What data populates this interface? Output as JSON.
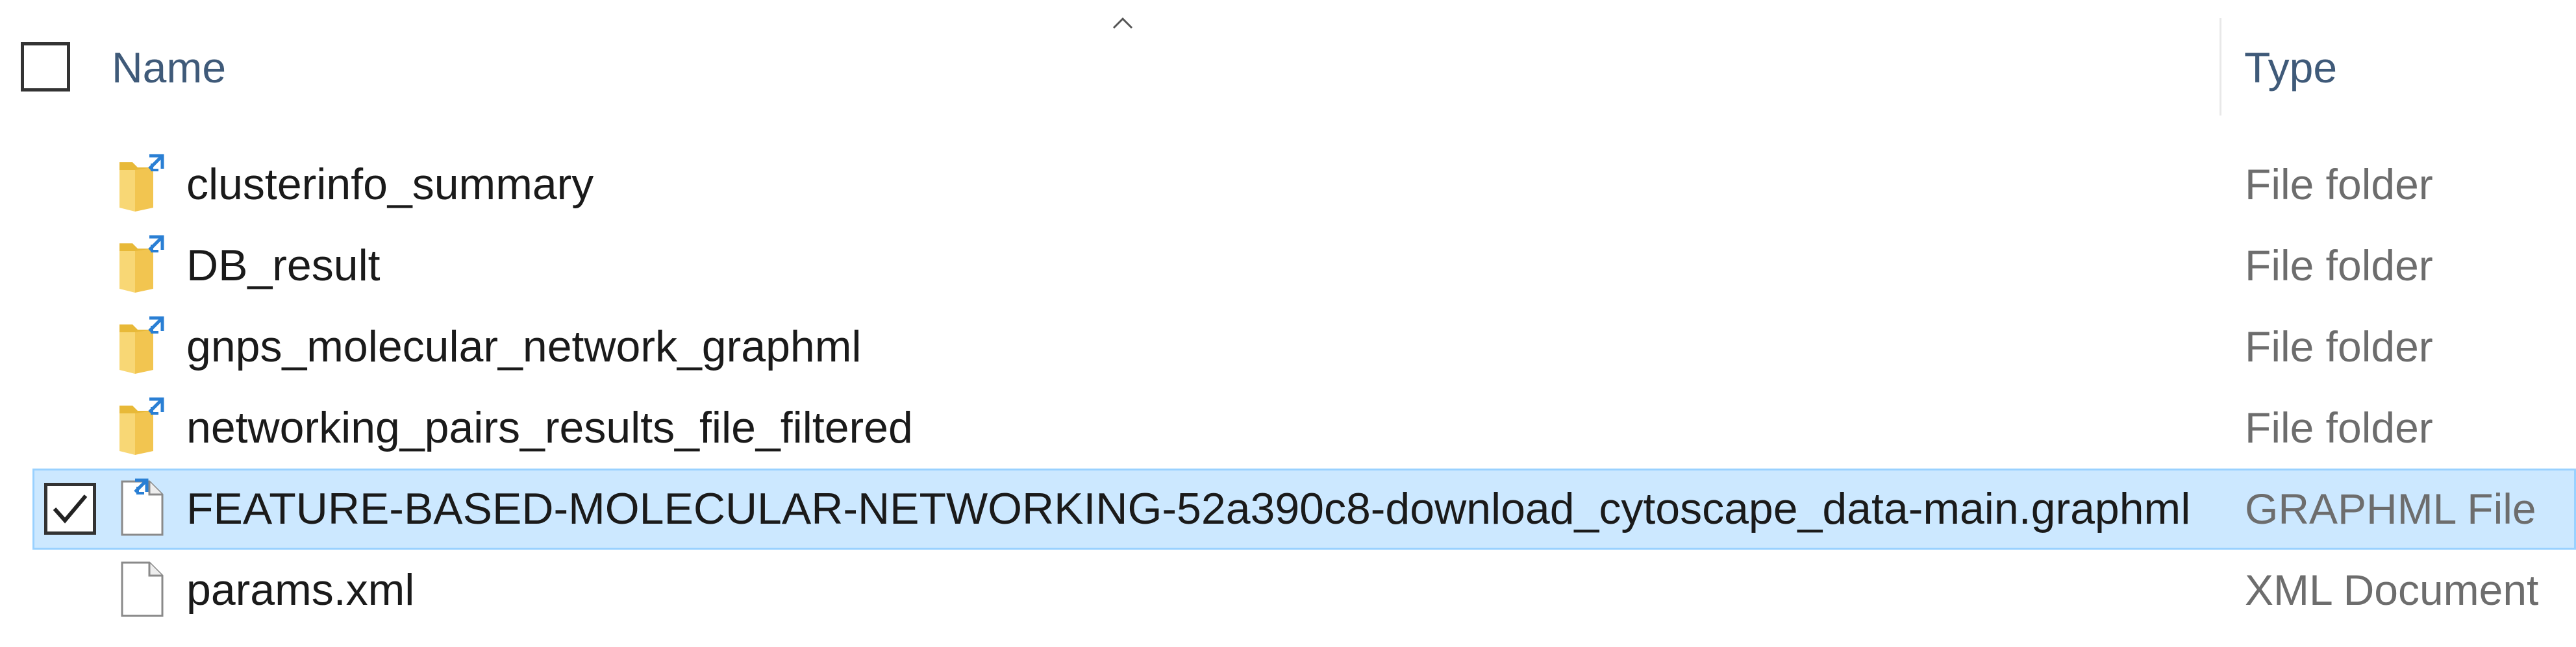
{
  "header": {
    "name_label": "Name",
    "type_label": "Type",
    "sort_icon": "chevron-up-icon"
  },
  "files": [
    {
      "name": "clusterinfo_summary",
      "type": "File folder",
      "icon": "folder-shortcut-icon",
      "selected": false
    },
    {
      "name": "DB_result",
      "type": "File folder",
      "icon": "folder-shortcut-icon",
      "selected": false
    },
    {
      "name": "gnps_molecular_network_graphml",
      "type": "File folder",
      "icon": "folder-shortcut-icon",
      "selected": false
    },
    {
      "name": "networking_pairs_results_file_filtered",
      "type": "File folder",
      "icon": "folder-shortcut-icon",
      "selected": false
    },
    {
      "name": "FEATURE-BASED-MOLECULAR-NETWORKING-52a390c8-download_cytoscape_data-main.graphml",
      "type": "GRAPHML File",
      "icon": "file-shortcut-icon",
      "selected": true
    },
    {
      "name": "params.xml",
      "type": "XML Document",
      "icon": "file-icon",
      "selected": false
    }
  ],
  "colors": {
    "selection_bg": "#cce8ff",
    "selection_border": "#99d1ff",
    "header_text": "#3f5a79",
    "type_text": "#6d6d6d"
  }
}
